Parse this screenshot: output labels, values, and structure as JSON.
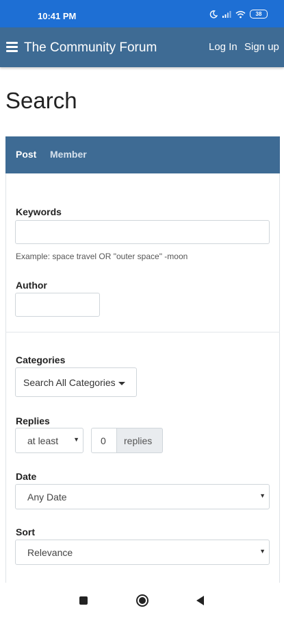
{
  "status_bar": {
    "time": "10:41 PM",
    "battery": "38",
    "icons": [
      "moon-icon",
      "signal-icon",
      "wifi-icon",
      "battery-icon"
    ]
  },
  "navbar": {
    "title": "The Community Forum",
    "login": "Log In",
    "signup": "Sign up"
  },
  "page": {
    "title": "Search"
  },
  "tabs": [
    {
      "label": "Post",
      "active": true
    },
    {
      "label": "Member",
      "active": false
    }
  ],
  "form": {
    "keywords": {
      "label": "Keywords",
      "value": "",
      "hint": "Example: space travel OR \"outer space\" -moon"
    },
    "author": {
      "label": "Author",
      "value": ""
    },
    "categories": {
      "label": "Categories",
      "selected": "Search All Categories"
    },
    "replies": {
      "label": "Replies",
      "mode": "at least",
      "count": "0",
      "unit": "replies"
    },
    "date": {
      "label": "Date",
      "selected": "Any Date"
    },
    "sort": {
      "label": "Sort",
      "selected": "Relevance"
    }
  },
  "colors": {
    "status_bar": "#1e6fd4",
    "header": "#3e6b94",
    "tabs": "#3e6b94"
  }
}
